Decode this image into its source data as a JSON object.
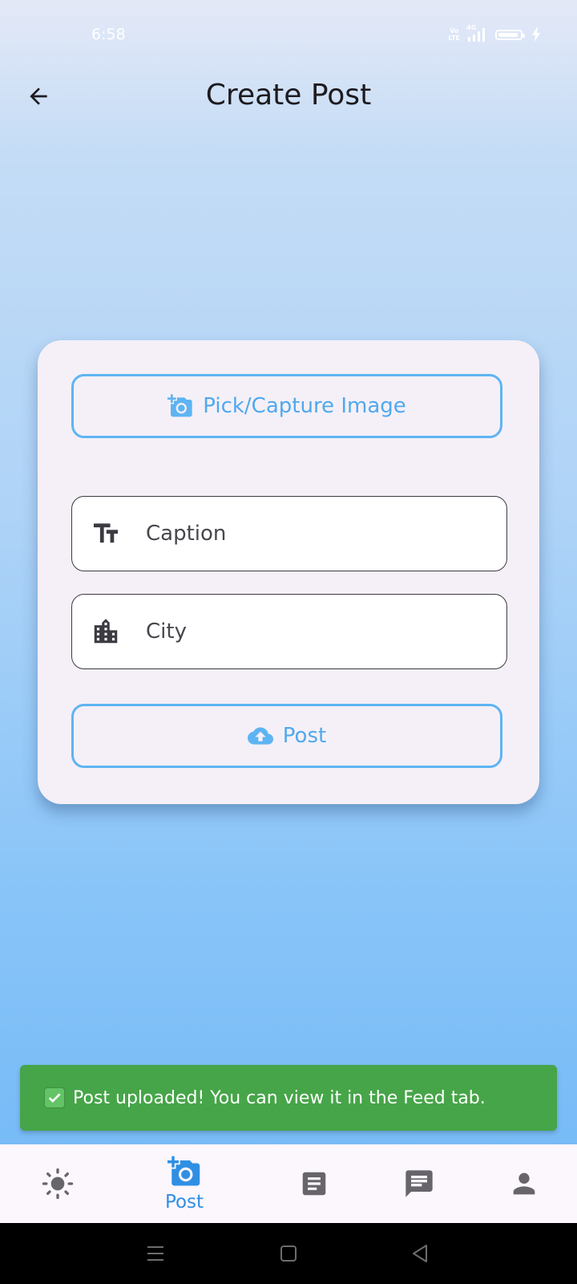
{
  "status_bar": {
    "time": "6:58",
    "network": "4G",
    "volte_top": "Vo",
    "volte_bottom": "LTE"
  },
  "app_bar": {
    "title": "Create Post",
    "back_icon": "arrow-back-icon"
  },
  "form": {
    "pick_image_label": "Pick/Capture Image",
    "pick_image_icon": "add-a-photo-icon",
    "caption_placeholder": "Caption",
    "caption_icon": "text-fields-icon",
    "caption_value": "",
    "city_placeholder": "City",
    "city_icon": "location-city-icon",
    "city_value": "",
    "post_label": "Post",
    "post_icon": "cloud-upload-icon"
  },
  "snackbar": {
    "text": "Post uploaded! You can view it in the Feed tab.",
    "icon": "check-mark-emoji"
  },
  "bottom_nav": {
    "items": [
      {
        "id": "weather",
        "icon": "sun-icon",
        "label": ""
      },
      {
        "id": "post",
        "icon": "add-a-photo-icon",
        "label": "Post",
        "selected": true
      },
      {
        "id": "feed",
        "icon": "article-icon",
        "label": ""
      },
      {
        "id": "chat",
        "icon": "chat-icon",
        "label": ""
      },
      {
        "id": "profile",
        "icon": "person-icon",
        "label": ""
      }
    ]
  },
  "colors": {
    "accent": "#4fa9ee",
    "snackbar": "#46a548",
    "card": "#f5f0f7",
    "nav_inactive": "#67656b"
  }
}
